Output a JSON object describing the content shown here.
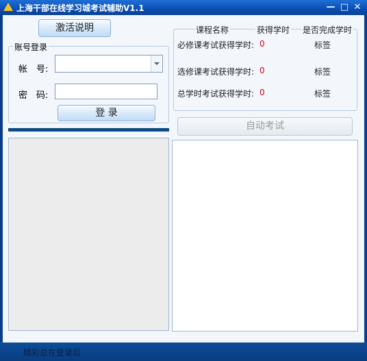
{
  "window": {
    "title": "上海干部在线学习城考试辅助V1.1",
    "controls": {
      "minimize": "—",
      "maximize": "□",
      "close": "✕"
    }
  },
  "left": {
    "activate_button": "激活说明",
    "login_group": "账号登录",
    "account_label": "帐　号:",
    "account_value": "",
    "password_label": "密　码:",
    "password_value": "",
    "login_button": "登 录"
  },
  "credits": {
    "headers": [
      "课程名称",
      "获得学时",
      "是否完成学时"
    ],
    "rows": [
      {
        "label": "必修课考试获得学时:",
        "value": "0",
        "tag": "标签"
      },
      {
        "label": "选修课考试获得学时:",
        "value": "0",
        "tag": "标签"
      },
      {
        "label": "总学时考试获得学时:",
        "value": "0",
        "tag": "标签"
      }
    ]
  },
  "right": {
    "auto_exam_button": "自动考试"
  },
  "status": {
    "text": "精彩总在登录后"
  },
  "colors": {
    "title_bar": "#0a4fb4",
    "value_red": "#d0021b",
    "accent_bar": "#0d4a86"
  }
}
